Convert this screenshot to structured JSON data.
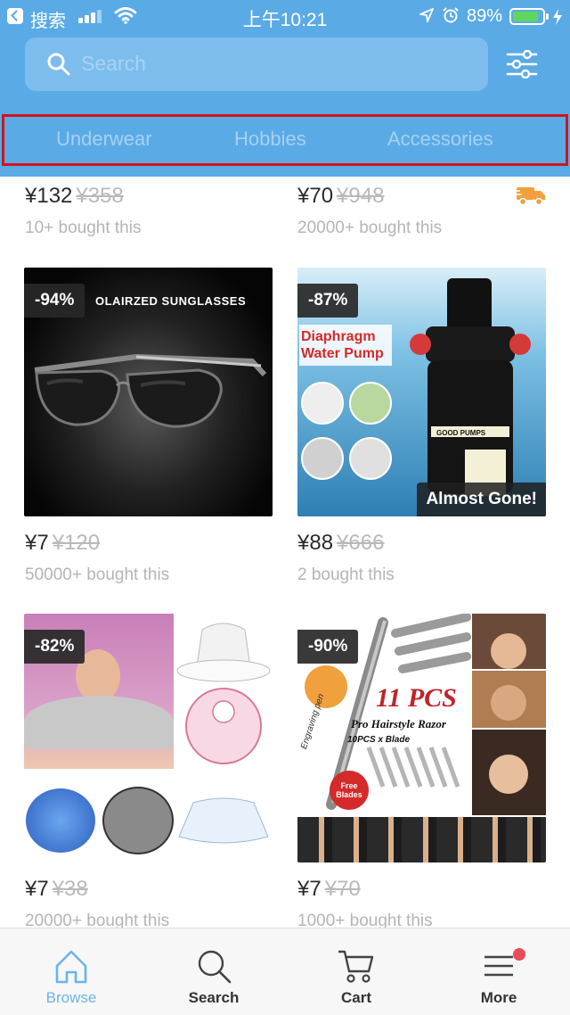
{
  "status_bar": {
    "app_name": "搜索",
    "time": "上午10:21",
    "battery_percent": "89%",
    "battery_level": 0.89
  },
  "header": {
    "search_placeholder": "Search",
    "categories": [
      "Underwear",
      "Hobbies",
      "Accessories"
    ]
  },
  "products": [
    {
      "price": "¥132",
      "old_price": "¥358",
      "bought": "10+ bought this"
    },
    {
      "price": "¥70",
      "old_price": "¥948",
      "bought": "20000+ bought this"
    },
    {
      "discount": "-94%",
      "image_text": "OLAIRZED SUNGLASSES",
      "price": "¥7",
      "old_price": "¥120",
      "bought": "50000+ bought this"
    },
    {
      "discount": "-87%",
      "image_title": "Diaphragm Water Pump",
      "brand": "GOOD PUMPS",
      "badge": "Almost Gone!",
      "price": "¥88",
      "old_price": "¥666",
      "bought": "2 bought this"
    },
    {
      "discount": "-82%",
      "price": "¥7",
      "old_price": "¥38",
      "bought": "20000+ bought this"
    },
    {
      "discount": "-90%",
      "image_title": "11 PCS",
      "image_subtitle": "Pro Hairstyle Razor",
      "image_note": "10PCS x Blade",
      "image_pen": "Engraving pen",
      "image_free": "Free Blades",
      "price": "¥7",
      "old_price": "¥70",
      "bought": "1000+ bought this"
    }
  ],
  "tabbar": {
    "tabs": [
      "Browse",
      "Search",
      "Cart",
      "More"
    ]
  },
  "colors": {
    "header": "#5aaae6",
    "accent_tab": "#6cb4e8",
    "highlight_border": "#d4131b"
  }
}
